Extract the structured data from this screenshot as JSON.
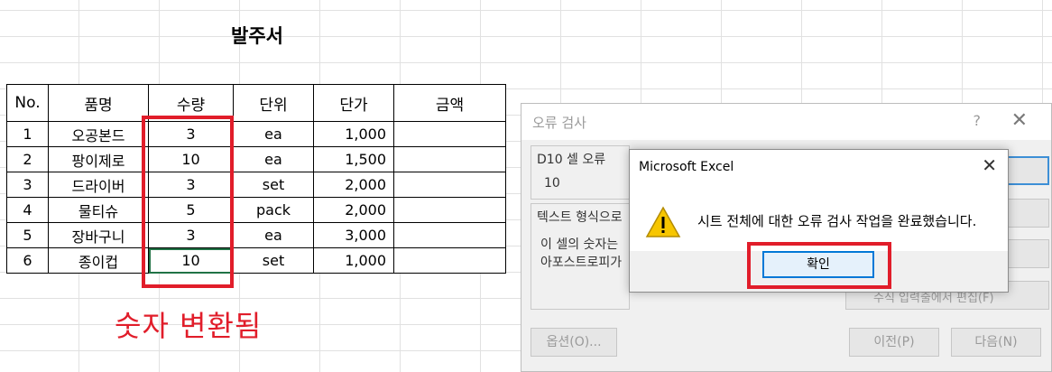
{
  "sheet": {
    "title": "발주서",
    "headers": [
      "No.",
      "품명",
      "수량",
      "단위",
      "단가",
      "금액"
    ],
    "rows": [
      [
        "1",
        "오공본드",
        "3",
        "ea",
        "1,000",
        ""
      ],
      [
        "2",
        "팡이제로",
        "10",
        "ea",
        "1,500",
        ""
      ],
      [
        "3",
        "드라이버",
        "3",
        "set",
        "2,000",
        ""
      ],
      [
        "4",
        "물티슈",
        "5",
        "pack",
        "2,000",
        ""
      ],
      [
        "5",
        "장바구니",
        "3",
        "ea",
        "3,000",
        ""
      ],
      [
        "6",
        "종이컵",
        "10",
        "set",
        "1,000",
        ""
      ]
    ],
    "annotation": "숫자 변환됨",
    "annotation_color": "#e11d2a"
  },
  "error_dialog": {
    "title": "오류 검사",
    "help": "?",
    "close": "✕",
    "cell_error_label": "D10 셀 오류",
    "cell_value": "10",
    "section_label": "텍스트 형식으로",
    "desc_line1": "이 셀의 숫자는",
    "desc_line2": "아포스트로피가",
    "right_button_partial": "수식 입력줄에서 편집(F)",
    "options_button": "옵션(O)...",
    "prev_button": "이전(P)",
    "next_button": "다음(N)"
  },
  "msgbox": {
    "title": "Microsoft Excel",
    "close": "✕",
    "message": "시트 전체에 대한 오류 검사 작업을 완료했습니다.",
    "ok_label": "확인",
    "icon": "warning-icon"
  },
  "colors": {
    "highlight_red": "#e11d2a",
    "focus_blue": "#0078d7",
    "excel_green": "#217346",
    "warning_yellow": "#f7c600"
  }
}
